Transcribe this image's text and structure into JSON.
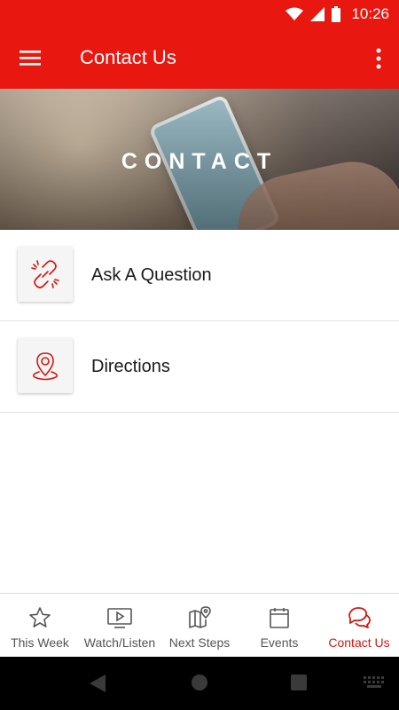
{
  "status_bar": {
    "time": "10:26",
    "icons": [
      "wifi-icon",
      "signal-icon",
      "battery-icon"
    ]
  },
  "app_bar": {
    "title": "Contact Us",
    "menu_icon": "hamburger-menu-icon",
    "more_icon": "more-vert-icon"
  },
  "hero": {
    "text": "CONTACT"
  },
  "list": {
    "items": [
      {
        "label": "Ask A Question",
        "icon": "broken-link-icon"
      },
      {
        "label": "Directions",
        "icon": "map-pin-icon"
      }
    ]
  },
  "tabs": [
    {
      "label": "This Week",
      "icon": "star-icon"
    },
    {
      "label": "Watch/Listen",
      "icon": "play-screen-icon"
    },
    {
      "label": "Next Steps",
      "icon": "map-icon"
    },
    {
      "label": "Events",
      "icon": "calendar-icon"
    },
    {
      "label": "Contact Us",
      "icon": "chat-bubbles-icon",
      "active": true
    }
  ],
  "colors": {
    "brand": "#e8170f",
    "active_tab": "#d5160e",
    "icon_stroke": "#d5160e"
  }
}
